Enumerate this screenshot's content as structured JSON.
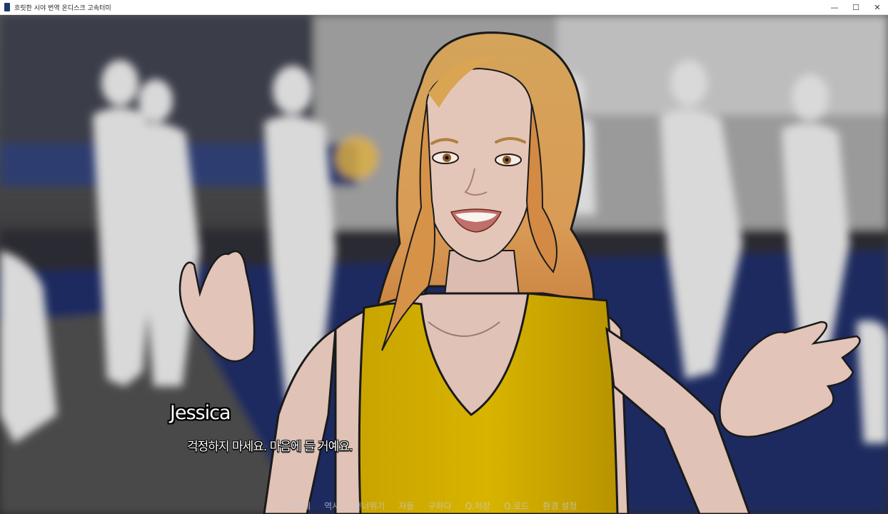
{
  "window": {
    "title": "흐릿한 시야 번역 온디스크 고속터미",
    "minimize_glyph": "—",
    "maximize_glyph": "☐",
    "close_glyph": "✕"
  },
  "dialogue": {
    "speaker": "Jessica",
    "text": "걱정하지 마세요. 마음에 들 거예요."
  },
  "quick_menu": {
    "items": [
      "뒤쪽에",
      "역사",
      "건너뛰기",
      "자동",
      "구하다",
      "Q.저장",
      "Q.로드",
      "환경 설정"
    ]
  },
  "colors": {
    "shirt": "#c9a800",
    "hair": "#d9a050",
    "skin": "#e2c0b2",
    "floor": "#1e2a5c"
  }
}
